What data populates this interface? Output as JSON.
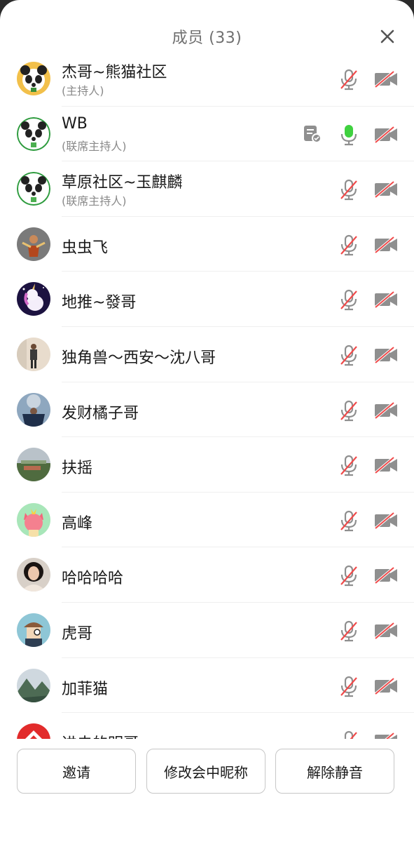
{
  "header": {
    "title": "成员 (33)"
  },
  "members": [
    {
      "name": "杰哥~熊猫社区",
      "role": "(主持人)",
      "avatar": "panda-gold",
      "mic": "muted",
      "cam": "off"
    },
    {
      "name": "WB",
      "role": "(联席主持人)",
      "avatar": "panda",
      "mic": "active",
      "cam": "off",
      "sharing": true
    },
    {
      "name": "草原社区~玉麒麟",
      "role": "(联席主持人)",
      "avatar": "panda",
      "mic": "muted",
      "cam": "off"
    },
    {
      "name": "虫虫飞",
      "role": "",
      "avatar": "character",
      "mic": "muted",
      "cam": "off"
    },
    {
      "name": "地推~發哥",
      "role": "",
      "avatar": "unicorn",
      "mic": "muted",
      "cam": "off"
    },
    {
      "name": "独角兽～西安～沈八哥",
      "role": "",
      "avatar": "person-standing",
      "mic": "muted",
      "cam": "off"
    },
    {
      "name": "发财橘子哥",
      "role": "",
      "avatar": "person-outdoor",
      "mic": "muted",
      "cam": "off"
    },
    {
      "name": "扶摇",
      "role": "",
      "avatar": "landscape-town",
      "mic": "muted",
      "cam": "off"
    },
    {
      "name": "高峰",
      "role": "",
      "avatar": "pink-cat",
      "mic": "muted",
      "cam": "off"
    },
    {
      "name": "哈哈哈哈",
      "role": "",
      "avatar": "woman-portrait",
      "mic": "muted",
      "cam": "off"
    },
    {
      "name": "虎哥",
      "role": "",
      "avatar": "cartoon-boy",
      "mic": "muted",
      "cam": "off"
    },
    {
      "name": "加菲猫",
      "role": "",
      "avatar": "mountain",
      "mic": "muted",
      "cam": "off"
    },
    {
      "name": "进击的明哥",
      "role": "",
      "avatar": "red-logo",
      "mic": "muted",
      "cam": "off"
    }
  ],
  "footer": {
    "invite": "邀请",
    "rename": "修改会中昵称",
    "unmute": "解除静音"
  },
  "colors": {
    "muted": "#f04a4a",
    "active": "#3fd13f",
    "icon": "#8f8f8f"
  }
}
